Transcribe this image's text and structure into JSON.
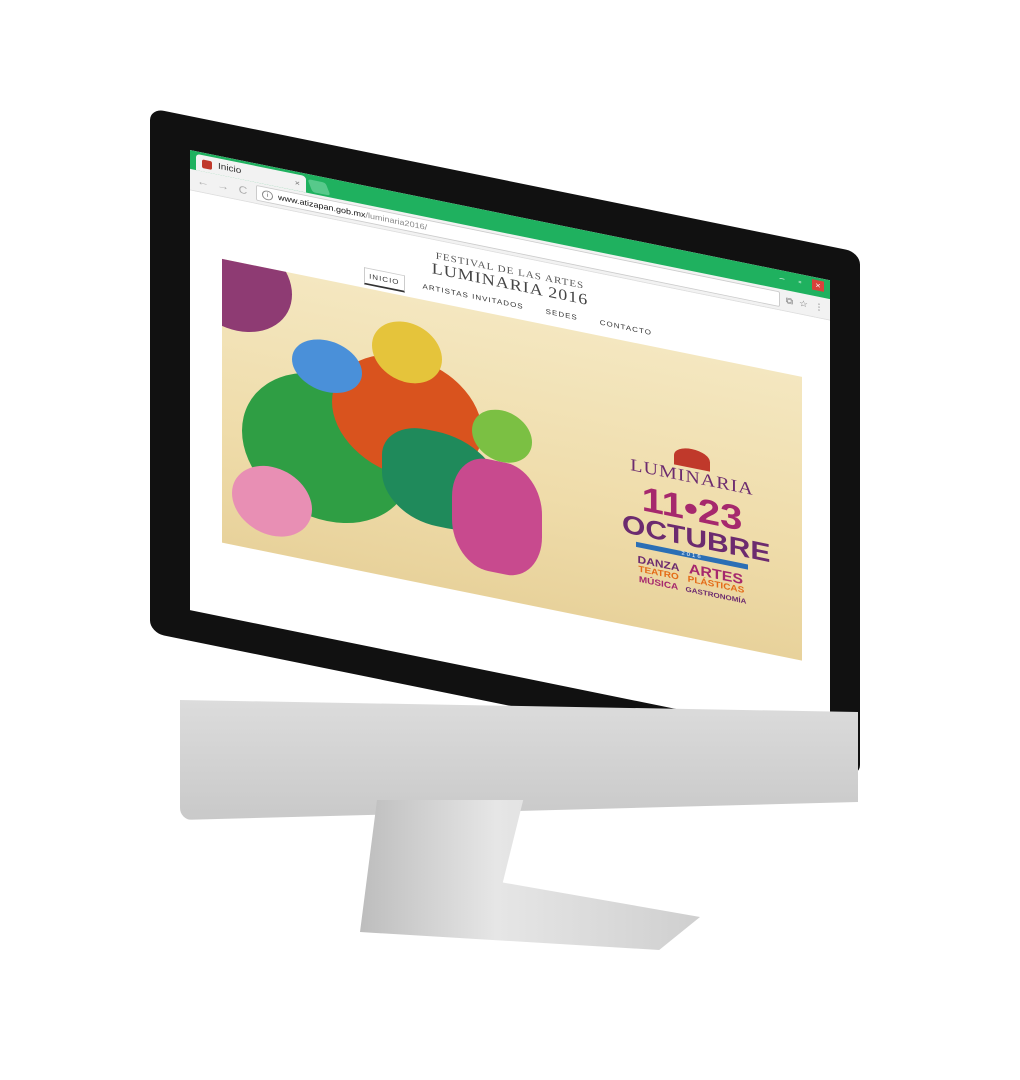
{
  "browser": {
    "tab_title": "Inicio",
    "tab_close": "×",
    "url_host": "www.atizapan.gob.mx",
    "url_path": "/luminaria2016/",
    "back": "←",
    "forward": "→",
    "reload": "C"
  },
  "site": {
    "subtitle": "FESTIVAL DE LAS ARTES",
    "title": "LUMINARIA 2016",
    "nav": [
      "INICIO",
      "ARTISTAS INVITADOS",
      "SEDES",
      "CONTACTO"
    ],
    "active_nav": "INICIO"
  },
  "hero": {
    "logo": "LUMINARIA",
    "dates": "11•23",
    "month": "OCTUBRE",
    "year": "2016",
    "events_left": [
      "DANZA",
      "TEATRO",
      "MÚSICA"
    ],
    "events_right": [
      "ARTES",
      "PLÁSTICAS",
      "GASTRONOMÍA"
    ]
  },
  "colors": {
    "chrome_accent": "#1fb15f",
    "brand_purple": "#6c2b6f",
    "brand_magenta": "#a6286d"
  }
}
